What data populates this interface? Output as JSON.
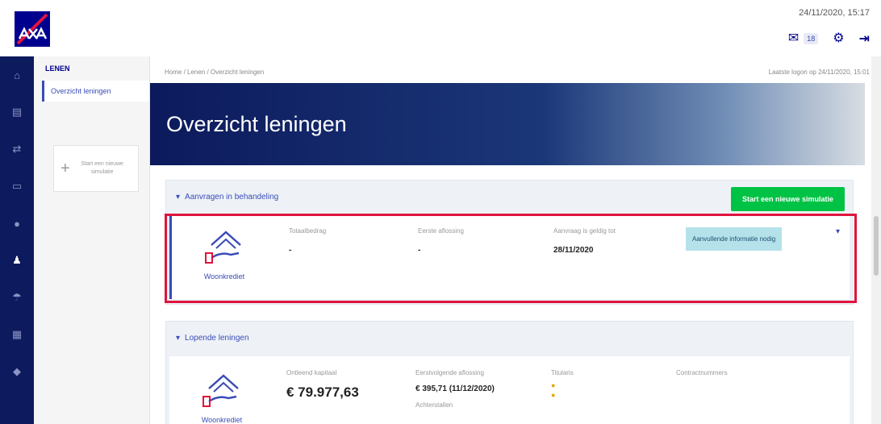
{
  "header": {
    "datetime": "24/11/2020, 15:17",
    "message_count": "18"
  },
  "subnav": {
    "title": "LENEN",
    "active_item": "Overzicht leningen",
    "new_sim_card": "Start een nieuwe simulatie"
  },
  "breadcrumb": "Home / Lenen / Overzicht leningen",
  "last_login": "Laatste logon op 24/11/2020, 15:01",
  "page_title": "Overzicht leningen",
  "pending": {
    "header": "Aanvragen in behandeling",
    "start_button": "Start een nieuwe simulatie",
    "loan": {
      "type": "Woonkrediet",
      "total_label": "Totaalbedrag",
      "total_value": "-",
      "first_label": "Eerste aflossing",
      "first_value": "-",
      "valid_label": "Aanvraag is geldig tot",
      "valid_value": "28/11/2020",
      "status_badge": "Aanvullende informatie nodig"
    }
  },
  "current": {
    "header": "Lopende leningen",
    "loan": {
      "type": "Woonkrediet",
      "capital_label": "Ontleend kapitaal",
      "capital_value": "€ 79.977,63",
      "next_label": "Eerstvolgende aflossing",
      "next_value": "€ 395,71 (11/12/2020)",
      "arrears_label": "Achterstallen",
      "holders_label": "Titularis",
      "contract_label": "Contractnummers"
    }
  },
  "colors": {
    "brand_blue": "#00008f",
    "nav_dark": "#0d1a5e",
    "green": "#00c244",
    "highlight_red": "#e0143d",
    "badge": "#b5e2ea"
  }
}
